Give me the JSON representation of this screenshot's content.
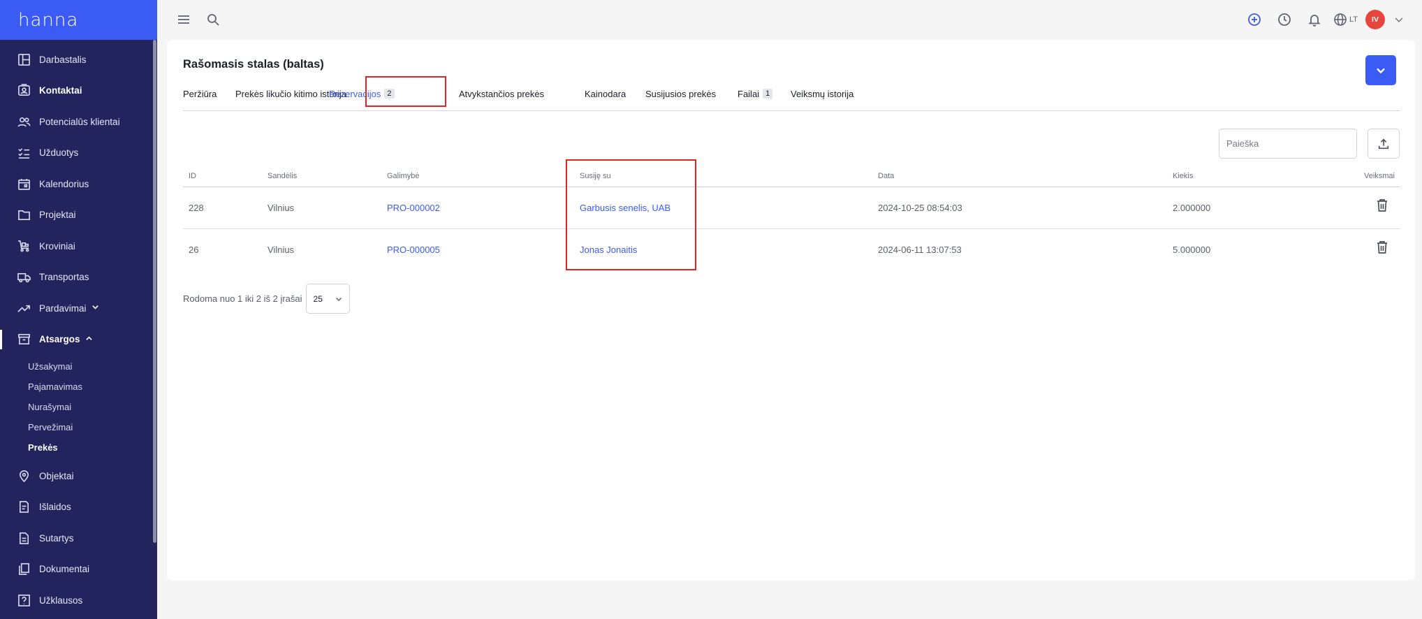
{
  "app": {
    "logo": "hanna"
  },
  "sidebar": {
    "items": [
      {
        "label": "Darbastalis",
        "icon": "dashboard-icon"
      },
      {
        "label": "Kontaktai",
        "icon": "contacts-icon"
      },
      {
        "label": "Potencialūs klientai",
        "icon": "people-icon"
      },
      {
        "label": "Užduotys",
        "icon": "checklist-icon"
      },
      {
        "label": "Kalendorius",
        "icon": "calendar-icon"
      },
      {
        "label": "Projektai",
        "icon": "folder-icon"
      },
      {
        "label": "Kroviniai",
        "icon": "cart-icon"
      },
      {
        "label": "Transportas",
        "icon": "truck-icon"
      },
      {
        "label": "Pardavimai",
        "icon": "trending-icon"
      },
      {
        "label": "Atsargos",
        "icon": "archive-icon"
      },
      {
        "label": "Objektai",
        "icon": "location-icon"
      },
      {
        "label": "Išlaidos",
        "icon": "receipt-icon"
      },
      {
        "label": "Sutartys",
        "icon": "document-icon"
      },
      {
        "label": "Dokumentai",
        "icon": "files-icon"
      },
      {
        "label": "Užklausos",
        "icon": "help-icon"
      }
    ],
    "atsargos_sub": [
      "Užsakymai",
      "Pajamavimas",
      "Nurašymai",
      "Pervežimai",
      "Prekės"
    ]
  },
  "topbar": {
    "lang": "LT",
    "avatar_initials": "IV"
  },
  "page": {
    "title": "Rašomasis stalas (baltas)",
    "tabs": [
      {
        "label": "Peržiūra",
        "badge": ""
      },
      {
        "label": "Prekės likučio kitimo istorija",
        "badge": ""
      },
      {
        "label": "Rezervacijos",
        "badge": "2"
      },
      {
        "label": "Atvykstančios prekės",
        "badge": ""
      },
      {
        "label": "Kainodara",
        "badge": ""
      },
      {
        "label": "Susijusios prekės",
        "badge": ""
      },
      {
        "label": "Failai",
        "badge": "1"
      },
      {
        "label": "Veiksmų istorija",
        "badge": ""
      }
    ],
    "search_placeholder": "Paieška"
  },
  "table": {
    "headers": {
      "id": "ID",
      "warehouse": "Sandėlis",
      "option": "Galimybė",
      "related": "Susiję su",
      "date": "Data",
      "qty": "Kiekis",
      "actions": "Veiksmai"
    },
    "rows": [
      {
        "id": "228",
        "warehouse": "Vilnius",
        "option": "PRO-000002",
        "related": "Garbusis senelis, UAB",
        "date": "2024-10-25 08:54:03",
        "qty": "2.000000"
      },
      {
        "id": "26",
        "warehouse": "Vilnius",
        "option": "PRO-000005",
        "related": "Jonas Jonaitis",
        "date": "2024-06-11 13:07:53",
        "qty": "5.000000"
      }
    ]
  },
  "pager": {
    "text": "Rodoma nuo 1 iki 2 iš 2 įrašai",
    "page_size": "25"
  },
  "colors": {
    "sidebar": "#23245e",
    "accent": "#3b5bf5",
    "highlight": "#e02424"
  }
}
